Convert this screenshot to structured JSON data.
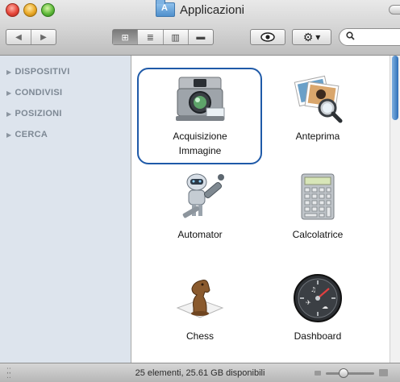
{
  "window": {
    "title": "Applicazioni",
    "status_text": "25 elementi, 25.61 GB disponibili"
  },
  "toolbar": {
    "back_icon": "back-arrow-icon",
    "forward_icon": "forward-arrow-icon",
    "view_modes": [
      {
        "name": "icon-view",
        "glyph": "⊞",
        "active": true
      },
      {
        "name": "list-view",
        "glyph": "≣",
        "active": false
      },
      {
        "name": "column-view",
        "glyph": "▥",
        "active": false
      },
      {
        "name": "coverflow-view",
        "glyph": "▬",
        "active": false
      }
    ],
    "quicklook_glyph": "👁",
    "action_glyph": "⚙",
    "action_arrow": "▾",
    "search_glyph": "⚲",
    "search_placeholder": ""
  },
  "sidebar": {
    "sections": [
      {
        "label": "DISPOSITIVI"
      },
      {
        "label": "CONDIVISI"
      },
      {
        "label": "POSIZIONI"
      },
      {
        "label": "CERCA"
      }
    ]
  },
  "files": [
    {
      "label_line1": "Acquisizione",
      "label_line2": "Immagine",
      "icon": "camera-icon",
      "selected": true
    },
    {
      "label_line1": "Anteprima",
      "label_line2": "",
      "icon": "preview-photos-icon",
      "selected": false
    },
    {
      "label_line1": "Automator",
      "label_line2": "",
      "icon": "automator-robot-icon",
      "selected": false
    },
    {
      "label_line1": "Calcolatrice",
      "label_line2": "",
      "icon": "calculator-icon",
      "selected": false
    },
    {
      "label_line1": "Chess",
      "label_line2": "",
      "icon": "chess-knight-icon",
      "selected": false
    },
    {
      "label_line1": "Dashboard",
      "label_line2": "",
      "icon": "dashboard-gauge-icon",
      "selected": false
    }
  ],
  "colors": {
    "selection_border": "#1f5aa8",
    "sidebar_bg": "#dde4ed",
    "sidebar_text": "#7d8894"
  }
}
